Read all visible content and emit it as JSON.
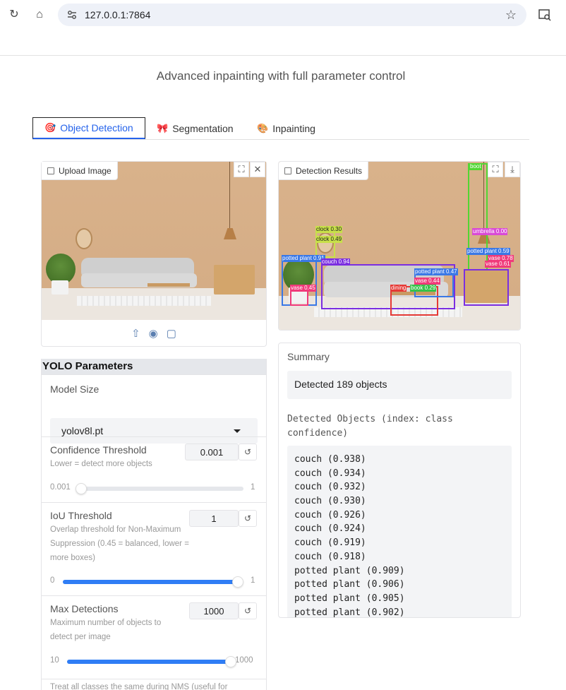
{
  "browser": {
    "url": "127.0.0.1:7864",
    "back_icon": "reload-icon",
    "home_icon": "home-icon"
  },
  "page": {
    "subtitle": "Advanced inpainting with full parameter control"
  },
  "tabs": [
    {
      "label": "Object Detection",
      "icon": "🎯"
    },
    {
      "label": "Segmentation",
      "icon": "🎀"
    },
    {
      "label": "Inpainting",
      "icon": "🎨"
    }
  ],
  "upload_panel": {
    "label": "Upload Image"
  },
  "results_panel": {
    "label": "Detection Results",
    "detections": [
      {
        "label": "clock 0.30",
        "color": "#c8e04a"
      },
      {
        "label": "clock 0.49",
        "color": "#c8e04a"
      },
      {
        "label": "potted plant 0.91",
        "color": "#3a78e6"
      },
      {
        "label": "couch 0.94",
        "color": "#7b2ee0"
      },
      {
        "label": "vase 0.45",
        "color": "#f03a7a"
      },
      {
        "label": "dining",
        "color": "#e53935"
      },
      {
        "label": "vase 0.44",
        "color": "#f03a7a"
      },
      {
        "label": "book 0.29",
        "color": "#36c24a"
      },
      {
        "label": "potted plant 0.47",
        "color": "#3a78e6"
      },
      {
        "label": "boot",
        "color": "#52d633"
      },
      {
        "label": "umbrella 0.00",
        "color": "#d94ad6"
      },
      {
        "label": "potted plant 0.59",
        "color": "#3a78e6"
      },
      {
        "label": "vase 0.78",
        "color": "#f03a7a"
      },
      {
        "label": "vase 0.61",
        "color": "#f03a7a"
      }
    ]
  },
  "params": {
    "title": "YOLO Parameters",
    "model_size": {
      "label": "Model Size",
      "value": "yolov8l.pt"
    },
    "confidence": {
      "label": "Confidence Threshold",
      "info": "Lower = detect more objects",
      "value": "0.001",
      "min": "0.001",
      "max": "1",
      "level": 0.0
    },
    "iou": {
      "label": "IoU Threshold",
      "info": "Overlap threshold for Non-Maximum Suppression (0.45 = balanced, lower = more boxes)",
      "value": "1",
      "min": "0",
      "max": "1",
      "level": 1.0
    },
    "max_det": {
      "label": "Max Detections",
      "info": "Maximum number of objects to detect per image",
      "value": "1000",
      "min": "10",
      "max": "1000",
      "level": 1.0
    },
    "agnostic_info": "Treat all classes the same during NMS (useful for"
  },
  "summary": {
    "title": "Summary",
    "text": "Detected 189 objects",
    "objects_heading": "Detected Objects (index: class confidence)",
    "objects": [
      "couch (0.938)",
      "couch (0.934)",
      "couch (0.932)",
      "couch (0.930)",
      "couch (0.926)",
      "couch (0.924)",
      "couch (0.919)",
      "couch (0.918)",
      "potted plant (0.909)",
      "potted plant (0.906)",
      "potted plant (0.905)",
      "potted plant (0.902)"
    ]
  }
}
